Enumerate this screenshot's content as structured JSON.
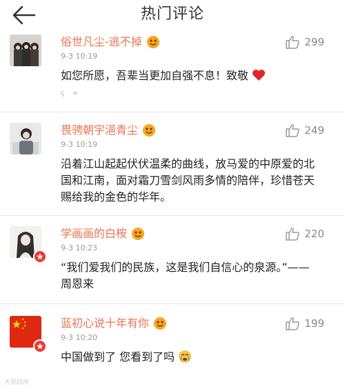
{
  "header": {
    "title": "热门评论",
    "back_icon": "arrow-left-icon"
  },
  "comments": [
    {
      "username": "俗世凡尘-逃不掉",
      "time": "9-3 10:19",
      "text": "如您所愿，吾辈当更加自强不息！致敬",
      "likes": "299",
      "mini_icons": "ç ∞"
    },
    {
      "username": "畏骋朝宇浥青尘",
      "time": "9-3 10:19",
      "text": "沿着江山起起伏伏温柔的曲线，放马爱的中原爱的北国和江南，面对霜刀雪剑风雨多情的陪伴，珍惜苍天赐给我的金色的华年。",
      "likes": "249"
    },
    {
      "username": "学画画的白桉",
      "time": "9-3 10:23",
      "text": "“我们爱我们的民族，这是我们自信心的泉源。”—— 周恩来",
      "likes": "220"
    },
    {
      "username": "蓝初心说十年有你",
      "time": "9-3 10:20",
      "text": "中国做到了 您看到了吗",
      "likes": "199"
    }
  ],
  "watermark": "大观四用",
  "colors": {
    "username": "#eb7350",
    "badge": "#ea3b2e",
    "heart": "#e0262c",
    "like": "#999999"
  }
}
